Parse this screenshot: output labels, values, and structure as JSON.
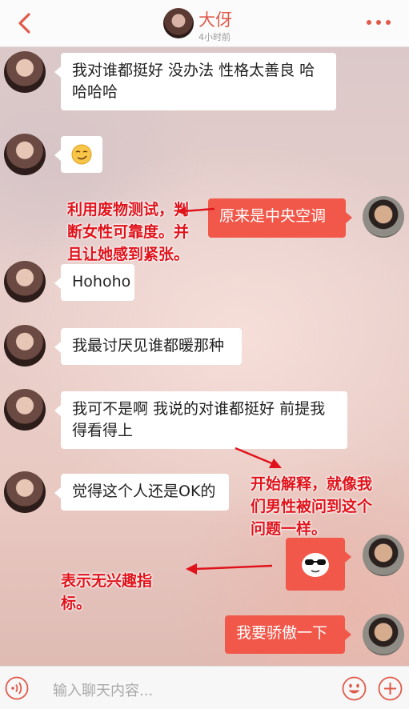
{
  "header": {
    "contact_name": "大伢",
    "last_active": "4小时前",
    "back_icon": "chevron-left-icon",
    "more_icon": "more-dots-icon",
    "accent_color": "#e05a4a"
  },
  "messages": [
    {
      "side": "left",
      "text": "我对谁都挺好 没办法 性格太善良 哈哈哈哈"
    },
    {
      "side": "left",
      "emoji": "smirk-face-icon"
    },
    {
      "side": "right",
      "text": "原来是中央空调"
    },
    {
      "side": "left",
      "text": "Hohoho"
    },
    {
      "side": "left",
      "text": "我最讨厌见谁都暖那种"
    },
    {
      "side": "left",
      "text": "我可不是啊 我说的对谁都挺好 前提我得看得上"
    },
    {
      "side": "left",
      "text": "觉得这个人还是OK的"
    },
    {
      "side": "right",
      "emoji": "sunglasses-face-icon"
    },
    {
      "side": "right",
      "text": "我要骄傲一下"
    }
  ],
  "annotations": [
    {
      "text": "利用废物测试，判断女性可靠度。并且让她感到紧张。"
    },
    {
      "text": "开始解释，就像我们男性被问到这个问题一样。"
    },
    {
      "text": "表示无兴趣指标。"
    }
  ],
  "annotation_color": "#e0131b",
  "bubble_color_self": "#f1584a",
  "input": {
    "placeholder": "输入聊天内容...",
    "voice_icon": "voice-icon",
    "emoji_icon": "emoji-icon",
    "plus_icon": "plus-icon"
  }
}
